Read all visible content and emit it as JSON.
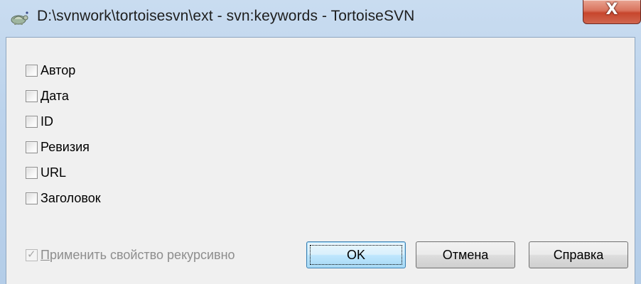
{
  "window": {
    "title": "D:\\svnwork\\tortoisesvn\\ext - svn:keywords - TortoiseSVN",
    "app_icon": "tortoise-icon",
    "close_label": "X"
  },
  "keywords": [
    {
      "label": "Автор",
      "checked": false
    },
    {
      "label": "Дата",
      "checked": false
    },
    {
      "label": "ID",
      "checked": false
    },
    {
      "label": "Ревизия",
      "checked": false
    },
    {
      "label": "URL",
      "checked": false
    },
    {
      "label": "Заголовок",
      "checked": false
    }
  ],
  "recursive": {
    "label_first": "П",
    "label_rest": "рименить свойство рекурсивно",
    "checked": true,
    "enabled": false
  },
  "buttons": {
    "ok": "OK",
    "cancel": "Отмена",
    "help": "Справка"
  }
}
